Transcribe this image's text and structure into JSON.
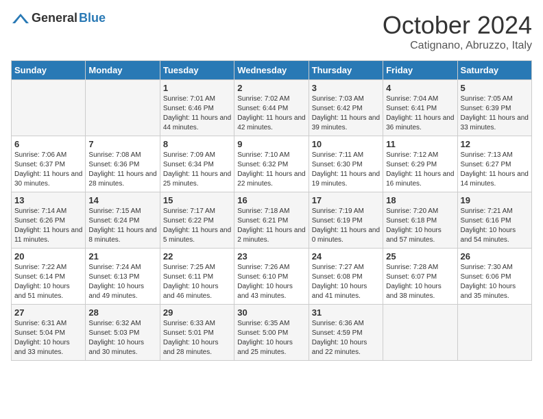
{
  "header": {
    "logo_general": "General",
    "logo_blue": "Blue",
    "month_title": "October 2024",
    "location": "Catignano, Abruzzo, Italy"
  },
  "days_of_week": [
    "Sunday",
    "Monday",
    "Tuesday",
    "Wednesday",
    "Thursday",
    "Friday",
    "Saturday"
  ],
  "weeks": [
    [
      {
        "day": "",
        "sunrise": "",
        "sunset": "",
        "daylight": ""
      },
      {
        "day": "",
        "sunrise": "",
        "sunset": "",
        "daylight": ""
      },
      {
        "day": "1",
        "sunrise": "Sunrise: 7:01 AM",
        "sunset": "Sunset: 6:46 PM",
        "daylight": "Daylight: 11 hours and 44 minutes."
      },
      {
        "day": "2",
        "sunrise": "Sunrise: 7:02 AM",
        "sunset": "Sunset: 6:44 PM",
        "daylight": "Daylight: 11 hours and 42 minutes."
      },
      {
        "day": "3",
        "sunrise": "Sunrise: 7:03 AM",
        "sunset": "Sunset: 6:42 PM",
        "daylight": "Daylight: 11 hours and 39 minutes."
      },
      {
        "day": "4",
        "sunrise": "Sunrise: 7:04 AM",
        "sunset": "Sunset: 6:41 PM",
        "daylight": "Daylight: 11 hours and 36 minutes."
      },
      {
        "day": "5",
        "sunrise": "Sunrise: 7:05 AM",
        "sunset": "Sunset: 6:39 PM",
        "daylight": "Daylight: 11 hours and 33 minutes."
      }
    ],
    [
      {
        "day": "6",
        "sunrise": "Sunrise: 7:06 AM",
        "sunset": "Sunset: 6:37 PM",
        "daylight": "Daylight: 11 hours and 30 minutes."
      },
      {
        "day": "7",
        "sunrise": "Sunrise: 7:08 AM",
        "sunset": "Sunset: 6:36 PM",
        "daylight": "Daylight: 11 hours and 28 minutes."
      },
      {
        "day": "8",
        "sunrise": "Sunrise: 7:09 AM",
        "sunset": "Sunset: 6:34 PM",
        "daylight": "Daylight: 11 hours and 25 minutes."
      },
      {
        "day": "9",
        "sunrise": "Sunrise: 7:10 AM",
        "sunset": "Sunset: 6:32 PM",
        "daylight": "Daylight: 11 hours and 22 minutes."
      },
      {
        "day": "10",
        "sunrise": "Sunrise: 7:11 AM",
        "sunset": "Sunset: 6:30 PM",
        "daylight": "Daylight: 11 hours and 19 minutes."
      },
      {
        "day": "11",
        "sunrise": "Sunrise: 7:12 AM",
        "sunset": "Sunset: 6:29 PM",
        "daylight": "Daylight: 11 hours and 16 minutes."
      },
      {
        "day": "12",
        "sunrise": "Sunrise: 7:13 AM",
        "sunset": "Sunset: 6:27 PM",
        "daylight": "Daylight: 11 hours and 14 minutes."
      }
    ],
    [
      {
        "day": "13",
        "sunrise": "Sunrise: 7:14 AM",
        "sunset": "Sunset: 6:26 PM",
        "daylight": "Daylight: 11 hours and 11 minutes."
      },
      {
        "day": "14",
        "sunrise": "Sunrise: 7:15 AM",
        "sunset": "Sunset: 6:24 PM",
        "daylight": "Daylight: 11 hours and 8 minutes."
      },
      {
        "day": "15",
        "sunrise": "Sunrise: 7:17 AM",
        "sunset": "Sunset: 6:22 PM",
        "daylight": "Daylight: 11 hours and 5 minutes."
      },
      {
        "day": "16",
        "sunrise": "Sunrise: 7:18 AM",
        "sunset": "Sunset: 6:21 PM",
        "daylight": "Daylight: 11 hours and 2 minutes."
      },
      {
        "day": "17",
        "sunrise": "Sunrise: 7:19 AM",
        "sunset": "Sunset: 6:19 PM",
        "daylight": "Daylight: 11 hours and 0 minutes."
      },
      {
        "day": "18",
        "sunrise": "Sunrise: 7:20 AM",
        "sunset": "Sunset: 6:18 PM",
        "daylight": "Daylight: 10 hours and 57 minutes."
      },
      {
        "day": "19",
        "sunrise": "Sunrise: 7:21 AM",
        "sunset": "Sunset: 6:16 PM",
        "daylight": "Daylight: 10 hours and 54 minutes."
      }
    ],
    [
      {
        "day": "20",
        "sunrise": "Sunrise: 7:22 AM",
        "sunset": "Sunset: 6:14 PM",
        "daylight": "Daylight: 10 hours and 51 minutes."
      },
      {
        "day": "21",
        "sunrise": "Sunrise: 7:24 AM",
        "sunset": "Sunset: 6:13 PM",
        "daylight": "Daylight: 10 hours and 49 minutes."
      },
      {
        "day": "22",
        "sunrise": "Sunrise: 7:25 AM",
        "sunset": "Sunset: 6:11 PM",
        "daylight": "Daylight: 10 hours and 46 minutes."
      },
      {
        "day": "23",
        "sunrise": "Sunrise: 7:26 AM",
        "sunset": "Sunset: 6:10 PM",
        "daylight": "Daylight: 10 hours and 43 minutes."
      },
      {
        "day": "24",
        "sunrise": "Sunrise: 7:27 AM",
        "sunset": "Sunset: 6:08 PM",
        "daylight": "Daylight: 10 hours and 41 minutes."
      },
      {
        "day": "25",
        "sunrise": "Sunrise: 7:28 AM",
        "sunset": "Sunset: 6:07 PM",
        "daylight": "Daylight: 10 hours and 38 minutes."
      },
      {
        "day": "26",
        "sunrise": "Sunrise: 7:30 AM",
        "sunset": "Sunset: 6:06 PM",
        "daylight": "Daylight: 10 hours and 35 minutes."
      }
    ],
    [
      {
        "day": "27",
        "sunrise": "Sunrise: 6:31 AM",
        "sunset": "Sunset: 5:04 PM",
        "daylight": "Daylight: 10 hours and 33 minutes."
      },
      {
        "day": "28",
        "sunrise": "Sunrise: 6:32 AM",
        "sunset": "Sunset: 5:03 PM",
        "daylight": "Daylight: 10 hours and 30 minutes."
      },
      {
        "day": "29",
        "sunrise": "Sunrise: 6:33 AM",
        "sunset": "Sunset: 5:01 PM",
        "daylight": "Daylight: 10 hours and 28 minutes."
      },
      {
        "day": "30",
        "sunrise": "Sunrise: 6:35 AM",
        "sunset": "Sunset: 5:00 PM",
        "daylight": "Daylight: 10 hours and 25 minutes."
      },
      {
        "day": "31",
        "sunrise": "Sunrise: 6:36 AM",
        "sunset": "Sunset: 4:59 PM",
        "daylight": "Daylight: 10 hours and 22 minutes."
      },
      {
        "day": "",
        "sunrise": "",
        "sunset": "",
        "daylight": ""
      },
      {
        "day": "",
        "sunrise": "",
        "sunset": "",
        "daylight": ""
      }
    ]
  ]
}
